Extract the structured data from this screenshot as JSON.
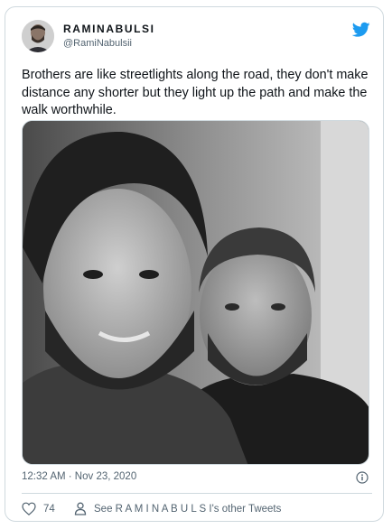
{
  "tweet": {
    "display_name": "RAMINABULSI",
    "handle": "@RamiNabulsii",
    "text": "Brothers are like streetlights along the road, they don't make distance any shorter but they light up the path and make the walk worthwhile.",
    "timestamp": "12:32 AM · Nov 23, 2020",
    "like_count": "74",
    "see_other_label": "See R A M I N A B U L S I's other Tweets"
  },
  "icons": {
    "brand": "twitter-bird-icon",
    "info": "info-icon",
    "like": "heart-icon",
    "profile": "person-icon"
  },
  "colors": {
    "brand_blue": "#1d9bf0",
    "text_primary": "#0f1419",
    "text_secondary": "#536471",
    "border": "#cfd9de"
  }
}
